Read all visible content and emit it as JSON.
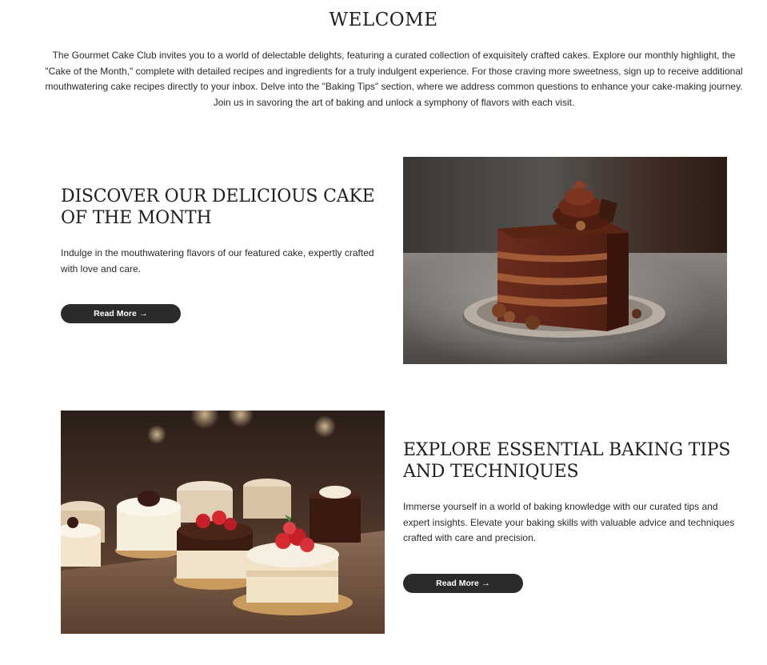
{
  "welcome": {
    "title": "WELCOME",
    "text": "The Gourmet Cake Club invites you to a world of delectable delights, featuring a curated collection of exquisitely crafted cakes. Explore our monthly highlight, the \"Cake of the Month,\" complete with detailed recipes and ingredients for a truly indulgent experience. For those craving more sweetness, sign up to receive additional mouthwatering cake recipes directly to your inbox. Delve into the \"Baking Tips\" section, where we address common questions to enhance your cake-making journey. Join us in savoring the art of baking and unlock a symphony of flavors with each visit."
  },
  "sections": [
    {
      "heading": "DISCOVER OUR DELICIOUS CAKE OF THE MONTH",
      "text": "Indulge in the mouthwatering flavors of our featured cake, expertly crafted with love and care.",
      "button_label": "Read More",
      "button_icon": "arrow-right-icon",
      "image": "chocolate-layer-cake-slice-photo"
    },
    {
      "heading": "EXPLORE ESSENTIAL BAKING TIPS AND TECHNIQUES",
      "text": "Immerse yourself in a world of baking knowledge with our curated tips and expert insights. Elevate your baking skills with valuable advice and techniques crafted with care and precision.",
      "button_label": "Read More",
      "button_icon": "arrow-right-icon",
      "image": "assorted-mini-cakes-display-photo"
    }
  ],
  "colors": {
    "button_bg": "#2b2b2b",
    "button_text": "#ffffff",
    "heading": "#1f1f1f",
    "body_text": "#2a2a2a"
  }
}
